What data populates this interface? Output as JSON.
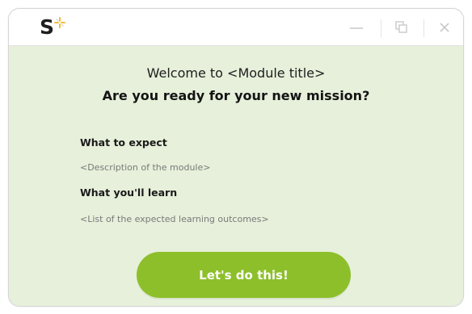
{
  "app": {
    "logo_letter": "S",
    "logo_icon": "sparkle-icon",
    "brand_color": "#1f1f1f",
    "accent_color": "#f2b21c"
  },
  "titlebar": {
    "controls": [
      {
        "name": "minimize",
        "icon": "minimize-icon"
      },
      {
        "name": "restore",
        "icon": "restore-icon"
      },
      {
        "name": "close",
        "icon": "close-icon"
      }
    ]
  },
  "content": {
    "welcome": "Welcome to <Module title>",
    "headline": "Are you ready for your new mission?",
    "sections": [
      {
        "title": "What to expect",
        "description": "<Description of the module>"
      },
      {
        "title": "What you'll learn",
        "description": "<List of the expected learning outcomes>"
      }
    ],
    "cta_label": "Let's do this!"
  },
  "colors": {
    "panel_bg": "#e6f0da",
    "titlebar_bg": "#ffffff",
    "button_bg": "#8dbf2a",
    "button_text": "#ffffff"
  }
}
